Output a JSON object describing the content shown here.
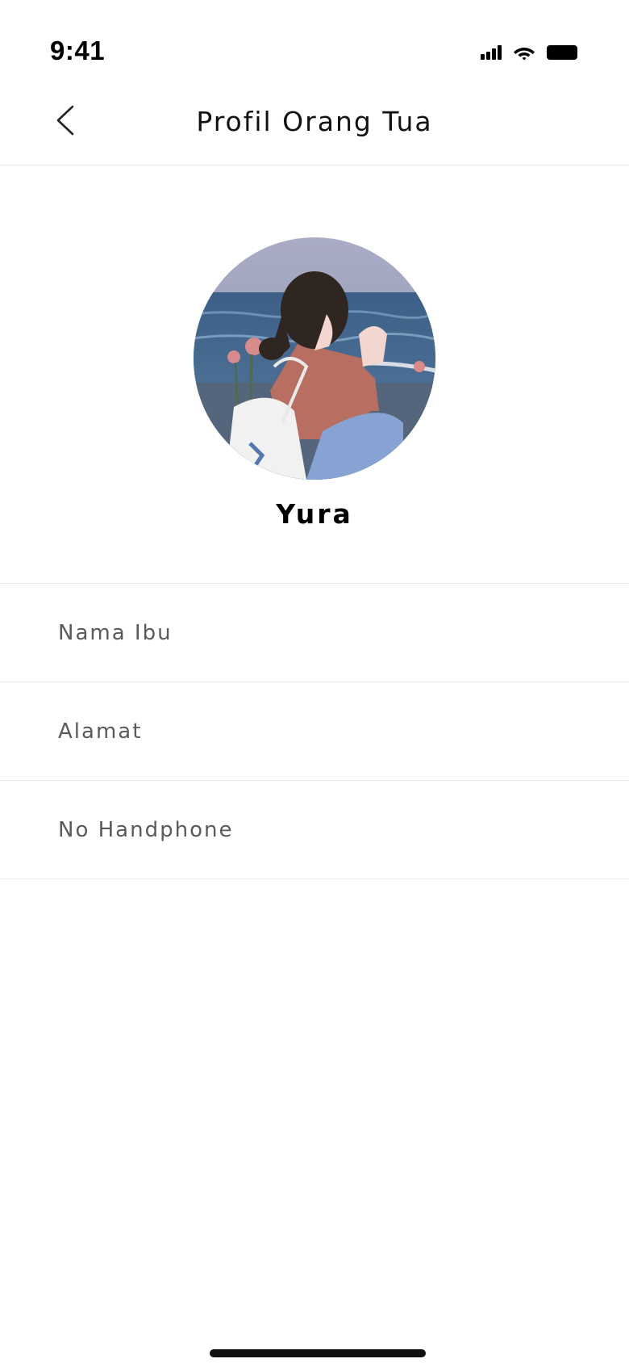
{
  "status_bar": {
    "time": "9:41",
    "icons": [
      "cellular-signal-icon",
      "wifi-icon",
      "battery-icon"
    ]
  },
  "header": {
    "back_icon": "chevron-left-icon",
    "title": "Profil Orang Tua"
  },
  "profile": {
    "avatar": "illustrated-girl-by-sea-avatar",
    "name": "Yura"
  },
  "info_rows": [
    {
      "label": "Nama Ibu"
    },
    {
      "label": "Alamat"
    },
    {
      "label": "No Handphone"
    }
  ],
  "colors": {
    "background": "#ffffff",
    "divider": "#ececec",
    "label_text": "#5a5a5a",
    "title_text": "#111111"
  }
}
